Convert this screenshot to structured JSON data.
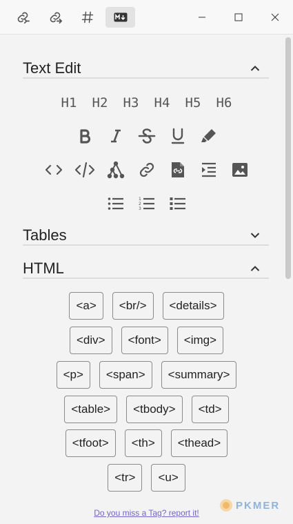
{
  "titlebar": {
    "icons": [
      "link-in-icon",
      "link-out-icon",
      "hashtag-icon",
      "markdown-icon"
    ],
    "window_controls": [
      "minimize-icon",
      "maximize-icon",
      "close-icon"
    ]
  },
  "sections": {
    "text_edit": {
      "title": "Text Edit",
      "state": "expanded"
    },
    "tables": {
      "title": "Tables",
      "state": "collapsed"
    },
    "html": {
      "title": "HTML",
      "state": "expanded"
    }
  },
  "headings": [
    "H1",
    "H2",
    "H3",
    "H4",
    "H5",
    "H6"
  ],
  "format_icons": [
    "bold-icon",
    "italic-icon",
    "strikethrough-icon",
    "underline-icon",
    "highlight-pen-icon"
  ],
  "insert_icons": [
    "inline-code-icon",
    "code-block-icon",
    "mindmap-icon",
    "link-icon",
    "embed-file-icon",
    "indent-icon",
    "image-icon"
  ],
  "list_icons": [
    "bullet-list-icon",
    "numbered-list-icon",
    "task-list-icon"
  ],
  "html_tags": [
    [
      "<a>",
      "<br/>",
      "<details>"
    ],
    [
      "<div>",
      "<font>",
      "<img>"
    ],
    [
      "<p>",
      "<span>",
      "<summary>"
    ],
    [
      "<table>",
      "<tbody>",
      "<td>"
    ],
    [
      "<tfoot>",
      "<th>",
      "<thead>"
    ],
    [
      "<tr>",
      "<u>"
    ]
  ],
  "footer": {
    "report_link": "Do you miss a Tag? report it!",
    "watermark": "PKMER"
  },
  "colors": {
    "icon": "#555555",
    "link": "#7563c6",
    "watermark": "#8fb3d9"
  }
}
